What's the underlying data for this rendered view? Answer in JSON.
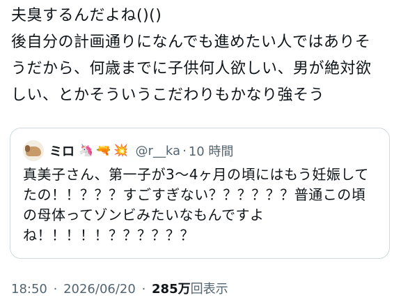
{
  "tweet": {
    "lines": [
      "夫臭するんだよね()()",
      "後自分の計画通りになんでも進めたい人ではありそ",
      "うだから、何歳までに子供何人欲しい、男が絶対欲",
      "しい、とかそういうこだわりもかなり強そう"
    ]
  },
  "quote": {
    "display_name": "ミロ",
    "emojis": [
      "🦄",
      "🔫",
      "💥"
    ],
    "handle": "@r__ka",
    "separator": "·",
    "time": "10 時間",
    "lines": [
      "真美子さん、第一子が3〜4ヶ月の頃にはもう妊娠して",
      "たの！！？？？すごすぎない？？？？？？普通この頃",
      "の母体ってゾンビみたいなもんですよ",
      "ね！！！！！？？？？？？"
    ]
  },
  "meta": {
    "time": "18:50",
    "separator1": "·",
    "date": "2026/06/20",
    "separator2": "·",
    "views_count": "285万",
    "views_label": "回表示"
  },
  "icons": {
    "avatar": "dog-avatar-icon",
    "emoji_1": "unicorn-icon",
    "emoji_2": "water-pistol-icon",
    "emoji_3": "collision-icon"
  },
  "colors": {
    "text": "#0f1419",
    "secondary": "#536471",
    "border": "#cfd9de"
  }
}
